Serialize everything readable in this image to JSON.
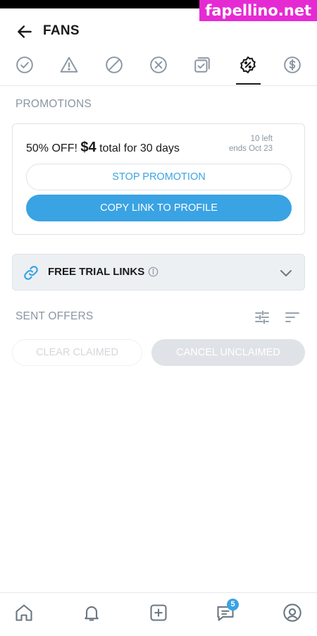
{
  "watermark": "fapellino.net",
  "header": {
    "title": "FANS"
  },
  "tabs": [
    {
      "name": "check-circle-icon",
      "active": false
    },
    {
      "name": "warning-triangle-icon",
      "active": false
    },
    {
      "name": "block-circle-icon",
      "active": false
    },
    {
      "name": "x-circle-icon",
      "active": false
    },
    {
      "name": "copy-check-icon",
      "active": false
    },
    {
      "name": "discount-badge-icon",
      "active": true
    },
    {
      "name": "dollar-circle-icon",
      "active": false
    }
  ],
  "promotions": {
    "section_label": "PROMOTIONS",
    "offer_prefix": "50% OFF!",
    "offer_price": "$4",
    "offer_suffix": "total for 30 days",
    "remaining": "10 left",
    "ends": "ends Oct 23",
    "stop_label": "STOP PROMOTION",
    "copy_label": "COPY LINK TO PROFILE"
  },
  "free_trial": {
    "label": "FREE TRIAL LINKS"
  },
  "sent_offers": {
    "section_label": "SENT OFFERS",
    "clear_label": "CLEAR CLAIMED",
    "cancel_label": "CANCEL UNCLAIMED"
  },
  "bottom_nav": {
    "items": [
      "home-icon",
      "bell-icon",
      "add-post-icon",
      "messages-icon",
      "profile-icon"
    ],
    "messages_badge": "5"
  },
  "colors": {
    "accent": "#3aa3e3",
    "muted": "#8a96a3",
    "watermark_bg": "#e62ad3"
  }
}
